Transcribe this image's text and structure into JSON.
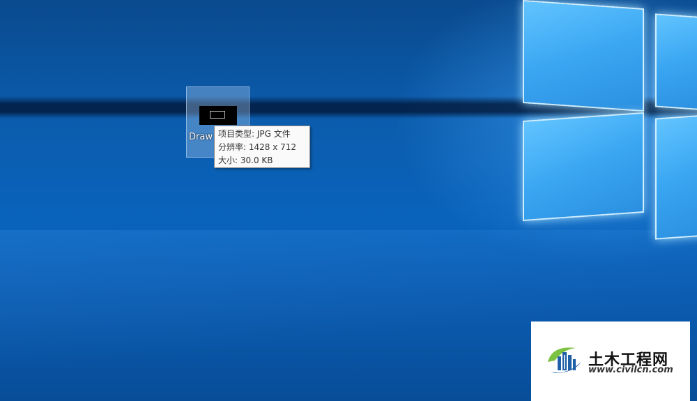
{
  "desktop": {
    "icon": {
      "label": "Draw",
      "icon": "jpg-file-thumbnail-icon"
    },
    "tooltip": {
      "type_line": "项目类型: JPG 文件",
      "resolution_line": "分辨率: 1428 x 712",
      "size_line": "大小: 30.0 KB"
    }
  },
  "watermark": {
    "title": "土木工程网",
    "url": "www.civilcn.com",
    "icon": "civilcn-logo-icon"
  },
  "colors": {
    "wallpaper_blue": "#0a63bb",
    "window_light": "#62c4ff",
    "tooltip_bg": "#fafafa"
  }
}
